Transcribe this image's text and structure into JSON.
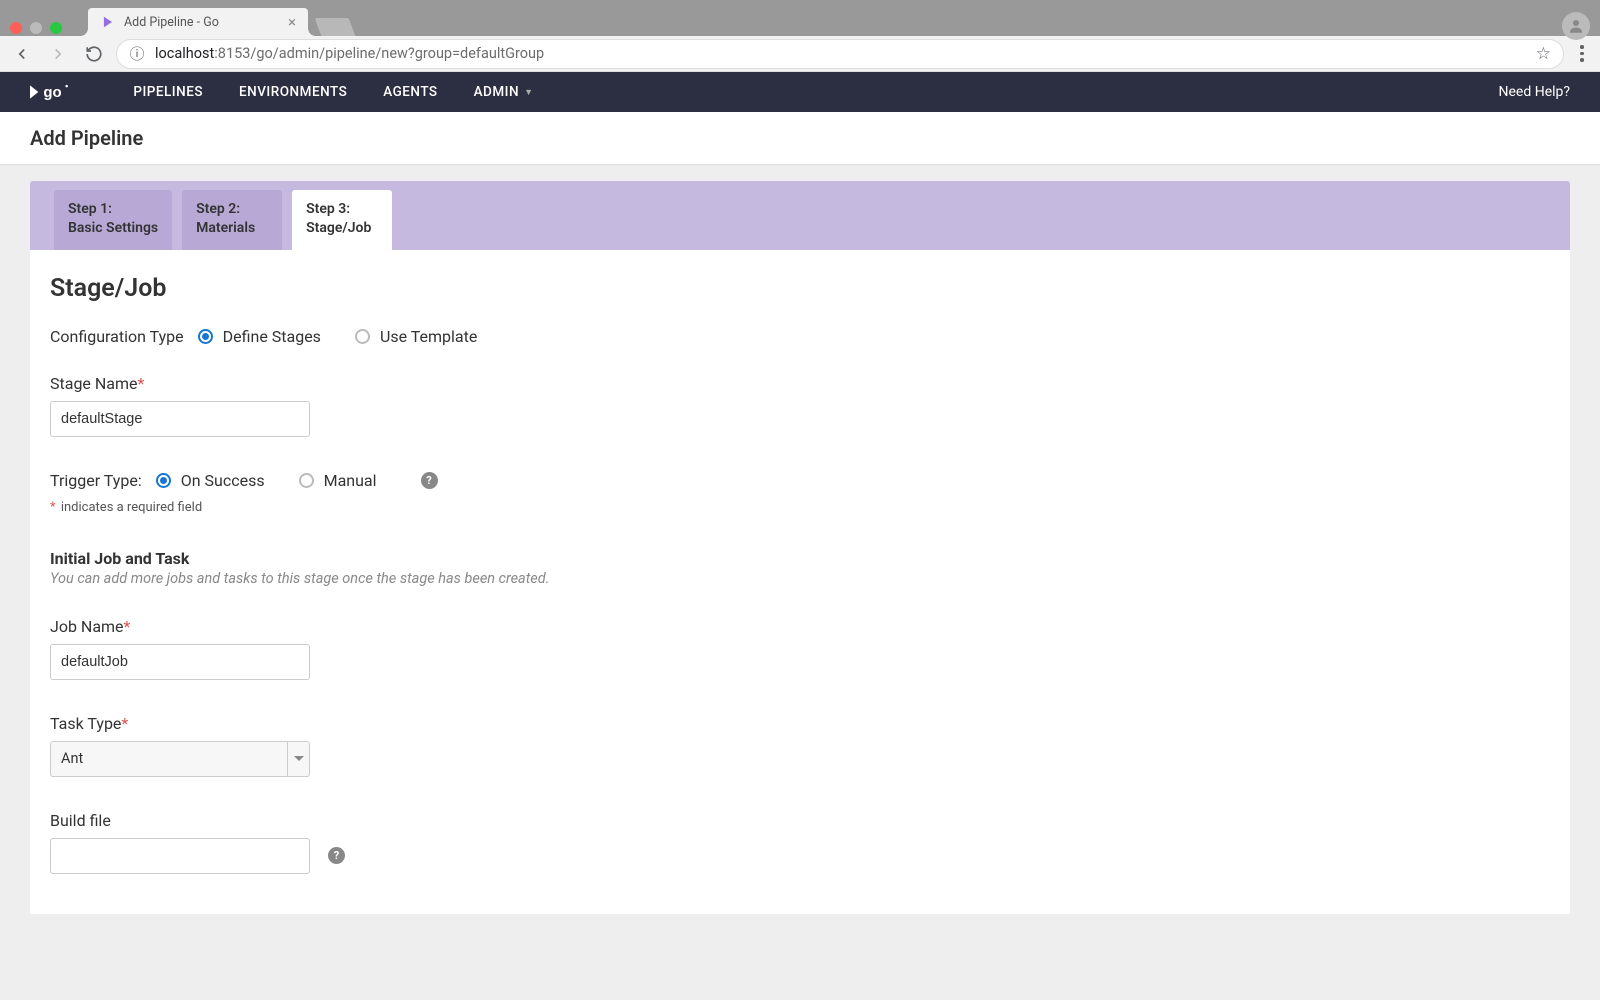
{
  "browser": {
    "tab_title": "Add Pipeline - Go",
    "url_host": "localhost",
    "url_path": ":8153/go/admin/pipeline/new?group=defaultGroup"
  },
  "nav": {
    "pipelines": "PIPELINES",
    "environments": "ENVIRONMENTS",
    "agents": "AGENTS",
    "admin": "ADMIN",
    "help": "Need Help?"
  },
  "page": {
    "title": "Add Pipeline"
  },
  "steps": {
    "s1l1": "Step 1:",
    "s1l2": "Basic Settings",
    "s2l1": "Step 2:",
    "s2l2": "Materials",
    "s3l1": "Step 3:",
    "s3l2": "Stage/Job"
  },
  "form": {
    "section_title": "Stage/Job",
    "config_type_label": "Configuration Type",
    "radio_define": "Define Stages",
    "radio_template": "Use Template",
    "stage_name_label": "Stage Name",
    "stage_name_value": "defaultStage",
    "trigger_label": "Trigger Type:",
    "radio_on_success": "On Success",
    "radio_manual": "Manual",
    "required_note": "indicates a required field",
    "subsection_title": "Initial Job and Task",
    "subsection_desc": "You can add more jobs and tasks to this stage once the stage has been created.",
    "job_name_label": "Job Name",
    "job_name_value": "defaultJob",
    "task_type_label": "Task Type",
    "task_type_value": "Ant",
    "build_file_label": "Build file",
    "build_file_value": ""
  }
}
